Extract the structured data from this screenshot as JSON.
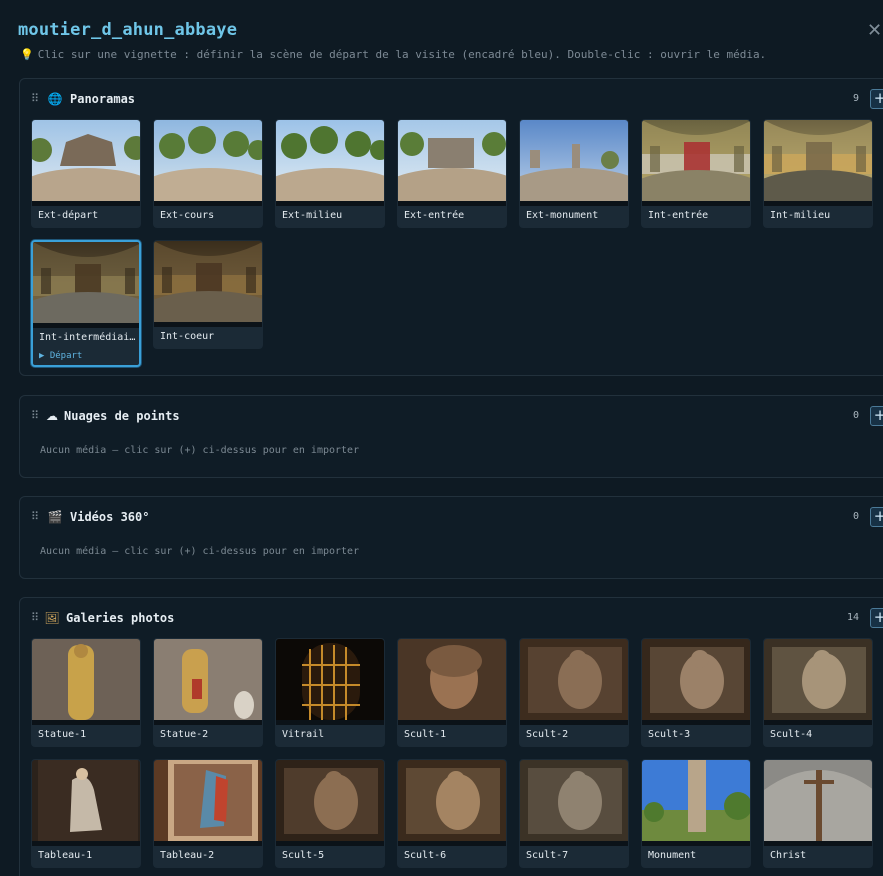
{
  "header": {
    "title": "moutier_d_ahun_abbaye",
    "hint": "Clic sur une vignette : définir la scène de départ de la visite (encadré bleu). Double-clic : ouvrir le média.",
    "close_icon": "close-icon"
  },
  "sections": {
    "panoramas": {
      "icon": "globe-icon",
      "title": "Panoramas",
      "count": "9",
      "add_label": "+",
      "items": [
        {
          "label": "Ext-départ"
        },
        {
          "label": "Ext-cours"
        },
        {
          "label": "Ext-milieu"
        },
        {
          "label": "Ext-entrée"
        },
        {
          "label": "Ext-monument"
        },
        {
          "label": "Int-entrée"
        },
        {
          "label": "Int-milieu"
        },
        {
          "label": "Int-intermédiaire",
          "badge": "▶ Départ",
          "selected": true
        },
        {
          "label": "Int-coeur"
        }
      ]
    },
    "point_clouds": {
      "icon": "cloud-icon",
      "title": "Nuages de points",
      "count": "0",
      "add_label": "+",
      "empty": "Aucun média — clic sur (+) ci-dessus pour en importer"
    },
    "videos": {
      "icon": "clapper-icon",
      "title": "Vidéos 360°",
      "count": "0",
      "add_label": "+",
      "empty": "Aucun média — clic sur (+) ci-dessus pour en importer"
    },
    "galleries": {
      "icon": "frame-picture-icon",
      "title": "Galeries photos",
      "count": "14",
      "add_label": "+",
      "items": [
        {
          "label": "Statue-1"
        },
        {
          "label": "Statue-2"
        },
        {
          "label": "Vitrail"
        },
        {
          "label": "Scult-1"
        },
        {
          "label": "Scult-2"
        },
        {
          "label": "Scult-3"
        },
        {
          "label": "Scult-4"
        },
        {
          "label": "Tableau-1"
        },
        {
          "label": "Tableau-2"
        },
        {
          "label": "Scult-5"
        },
        {
          "label": "Scult-6"
        },
        {
          "label": "Scult-7"
        },
        {
          "label": "Monument"
        },
        {
          "label": "Christ"
        }
      ]
    }
  },
  "colors": {
    "accent": "#6fc6e8",
    "selected_border": "#3aa0d8"
  }
}
